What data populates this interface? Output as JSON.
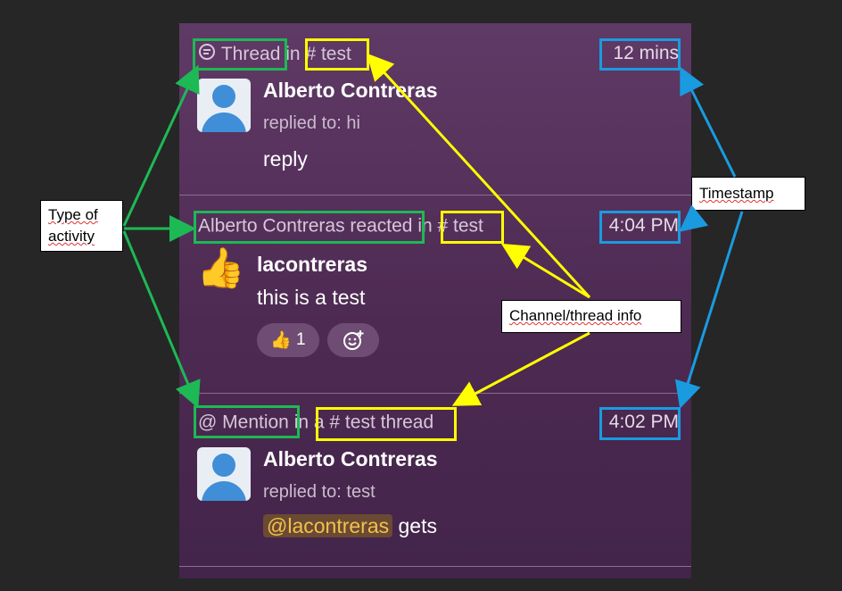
{
  "items": [
    {
      "type_label": "Thread",
      "in_text": "in",
      "channel": "# test",
      "timestamp": "12 mins",
      "author": "Alberto Contreras",
      "subtitle": "replied to: hi",
      "message": "reply"
    },
    {
      "type_label": "Alberto Contreras reacted",
      "in_text": "in",
      "channel": "# test",
      "timestamp": "4:04 PM",
      "author": "lacontreras",
      "message": "this is a test",
      "reaction_emoji": "👍",
      "reaction_count": "1",
      "add_reaction_icon": "add-emoji-icon"
    },
    {
      "type_label": "@ Mention",
      "in_text": "in a",
      "channel": "# test thread",
      "timestamp": "4:02 PM",
      "author": "Alberto Contreras",
      "subtitle": "replied to: test",
      "mention": "@lacontreras",
      "message_rest": "gets"
    }
  ],
  "annotations": {
    "type_of_activity": "Type of activity",
    "timestamp": "Timestamp",
    "channel_thread_info": "Channel/thread info"
  },
  "colors": {
    "activity_type": "#1db954",
    "channel_info": "#ffff00",
    "timestamp": "#1a9be0"
  }
}
